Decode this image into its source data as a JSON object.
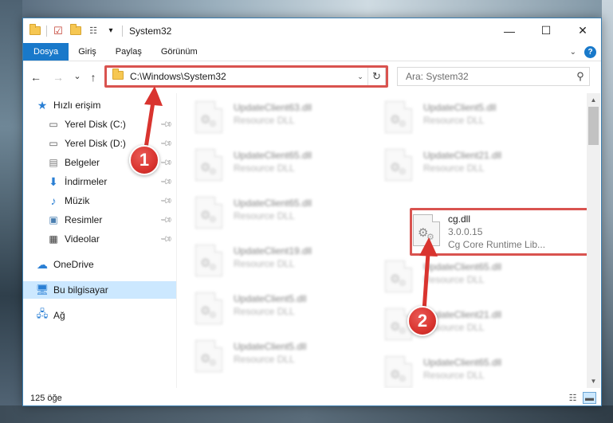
{
  "window": {
    "title": "System32",
    "controls": {
      "minimize": "—",
      "maximize": "☐",
      "close": "✕"
    }
  },
  "quick_access_toolbar": {
    "dropdown_glyph": "▾"
  },
  "ribbon": {
    "tabs": [
      {
        "label": "Dosya",
        "active": true
      },
      {
        "label": "Giriş",
        "active": false
      },
      {
        "label": "Paylaş",
        "active": false
      },
      {
        "label": "Görünüm",
        "active": false
      }
    ],
    "help_glyph": "?"
  },
  "navigation": {
    "back_glyph": "←",
    "forward_glyph": "→",
    "recent_glyph": "⌄",
    "up_glyph": "↑",
    "address": "C:\\Windows\\System32",
    "refresh_glyph": "↻",
    "search_placeholder": "Ara: System32"
  },
  "sidebar": {
    "quick_access": "Hızlı erişim",
    "items": [
      {
        "label": "Yerel Disk (C:)",
        "icon": "drive-c-icon",
        "pinned": true
      },
      {
        "label": "Yerel Disk (D:)",
        "icon": "drive-d-icon",
        "pinned": true
      },
      {
        "label": "Belgeler",
        "icon": "documents-icon",
        "pinned": true
      },
      {
        "label": "İndirmeler",
        "icon": "downloads-icon",
        "pinned": true
      },
      {
        "label": "Müzik",
        "icon": "music-icon",
        "pinned": true
      },
      {
        "label": "Resimler",
        "icon": "pictures-icon",
        "pinned": true
      },
      {
        "label": "Videolar",
        "icon": "videos-icon",
        "pinned": true
      }
    ],
    "onedrive": "OneDrive",
    "this_pc": "Bu bilgisayar",
    "network": "Ağ"
  },
  "files": {
    "left_column": [
      {
        "name": "UpdateClient63.dll",
        "desc": "Resource DLL"
      },
      {
        "name": "UpdateClient65.dll",
        "desc": "Resource DLL"
      },
      {
        "name": "UpdateClient65.dll",
        "desc": "Resource DLL"
      },
      {
        "name": "UpdateClient19.dll",
        "desc": "Resource DLL"
      },
      {
        "name": "UpdateClient5.dll",
        "desc": "Resource DLL"
      },
      {
        "name": "UpdateClient5.dll",
        "desc": "Resource DLL"
      }
    ],
    "right_column": [
      {
        "name": "UpdateClient5.dll",
        "desc": "Resource DLL"
      },
      {
        "name": "UpdateClient21.dll",
        "desc": "Resource DLL"
      },
      {
        "name": "UpdateClient65.dll",
        "desc": "Resource DLL"
      },
      {
        "name": "UpdateClient21.dll",
        "desc": "Resource DLL"
      },
      {
        "name": "UpdateClient65.dll",
        "desc": "Resource DLL"
      }
    ],
    "highlighted": {
      "name": "cg.dll",
      "version": "3.0.0.15",
      "desc": "Cg Core Runtime Lib..."
    }
  },
  "status": {
    "item_count": "125 öğe"
  },
  "view_buttons": {
    "details_glyph": "☷",
    "tiles_glyph": "▬"
  },
  "annotations": {
    "badge_1": "1",
    "badge_2": "2",
    "highlight_color": "#d9534f"
  },
  "colors": {
    "accent": "#1979ca",
    "selected_bg": "#cce8ff"
  }
}
